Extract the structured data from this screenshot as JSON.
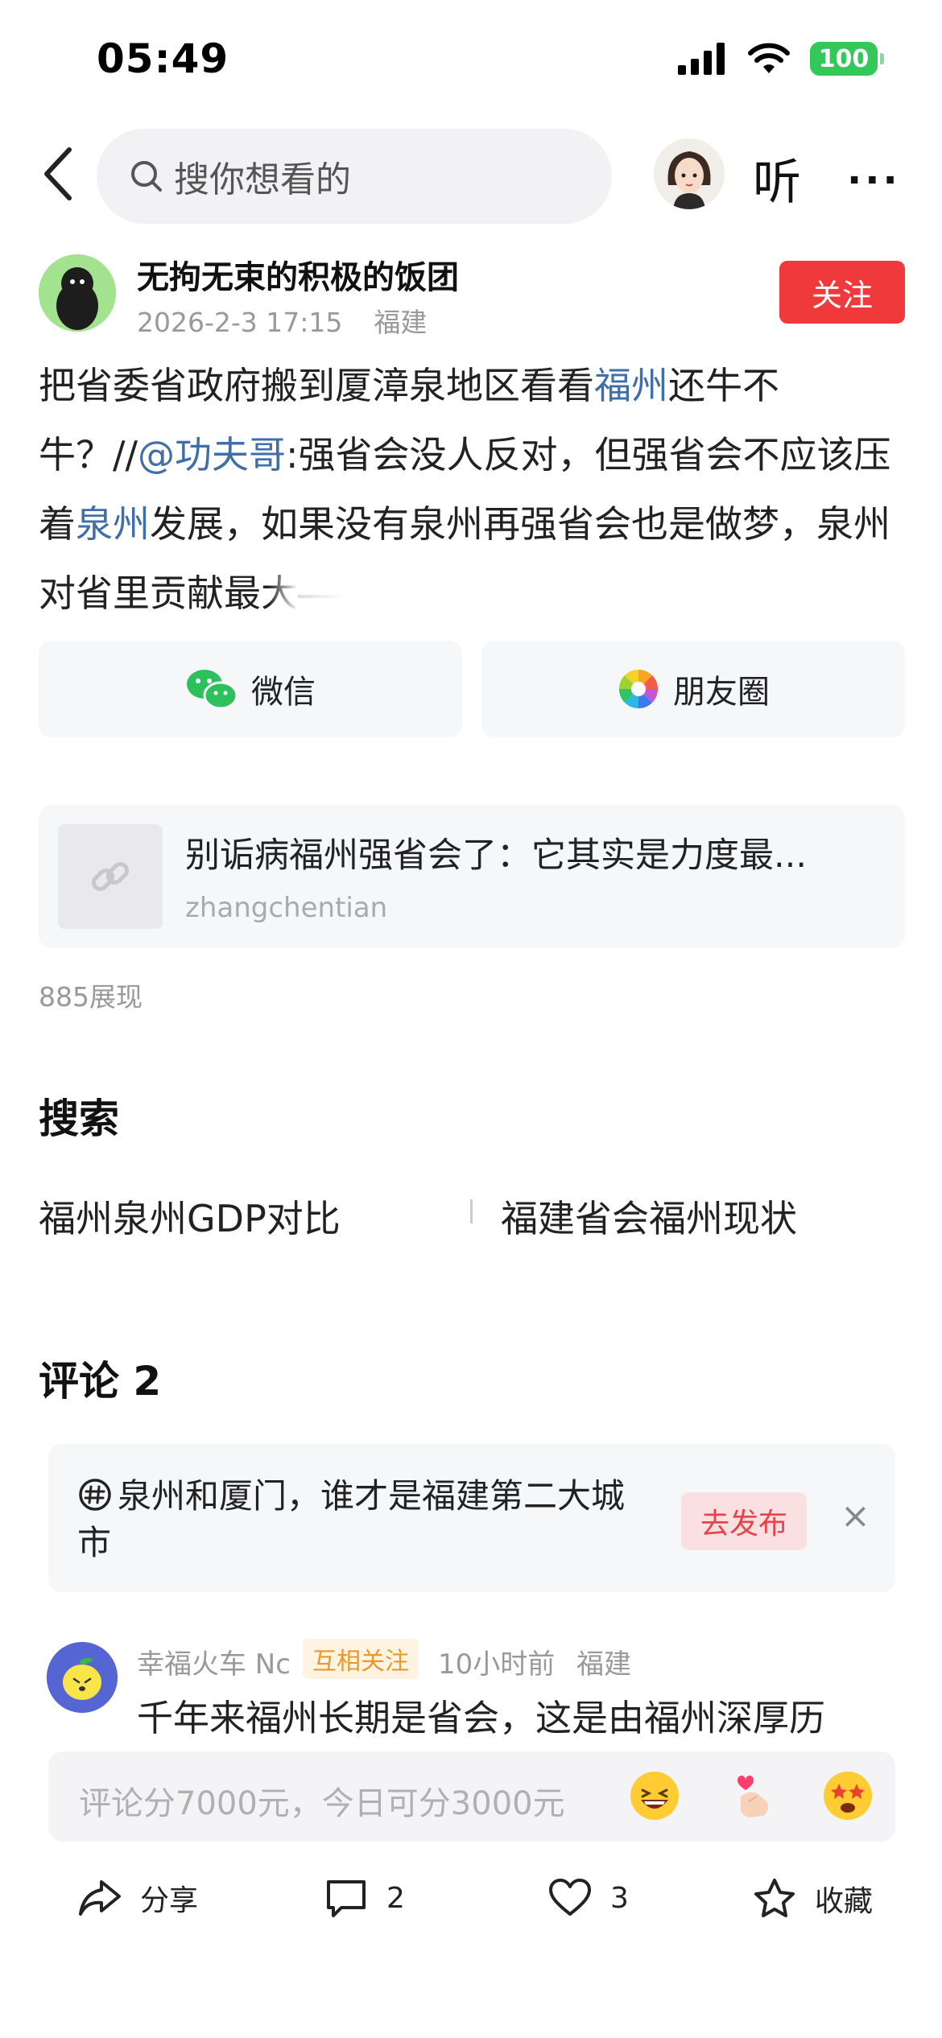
{
  "status_bar": {
    "time": "05:49",
    "battery": "100"
  },
  "top_bar": {
    "search_placeholder": "搜你想看的",
    "listen_label": "听",
    "more_label": "···"
  },
  "author": {
    "name": "无拘无束的积极的饭团",
    "date": "2026-2-3 17:15",
    "location": "福建",
    "follow_label": "关注"
  },
  "post": {
    "segments": [
      {
        "text": "把省委省政府搬到厦漳泉地区看看",
        "type": "text"
      },
      {
        "text": "福州",
        "type": "link"
      },
      {
        "text": "还牛不牛？//",
        "type": "text"
      },
      {
        "text": "@功夫哥",
        "type": "link"
      },
      {
        "text": ":强省会没人反对，但强省会不应该压着",
        "type": "text"
      },
      {
        "text": "泉州",
        "type": "link"
      },
      {
        "text": "发展，如果没有泉州再强省会也是做梦，泉州对省里贡献最",
        "type": "text"
      },
      {
        "text": "大",
        "type": "fade"
      }
    ]
  },
  "share": {
    "wechat_label": "微信",
    "moments_label": "朋友圈"
  },
  "link_card": {
    "title": "别诟病福州强省会了：它其实是力度最...",
    "source": "zhangchentian"
  },
  "views": "885展现",
  "search_section": {
    "title": "搜索",
    "suggestions": [
      "福州泉州GDP对比",
      "福建省会福州现状"
    ]
  },
  "comments": {
    "title": "评论 2",
    "topic": {
      "text": "泉州和厦门，谁才是福建第二大城市",
      "publish_label": "去发布",
      "close_label": "×"
    },
    "items": [
      {
        "user": "幸福火车 Nc",
        "badge": "互相关注",
        "time": "10小时前",
        "location": "福建",
        "text": "千年来福州长期是省会，这是由福州深厚历"
      }
    ],
    "input_placeholder": "评论分7000元，今日可分3000元"
  },
  "bottom_bar": {
    "share_label": "分享",
    "comment_count": "2",
    "like_count": "3",
    "favorite_label": "收藏"
  },
  "colors": {
    "link_blue": "#3f6ea8",
    "follow_red": "#f0393a",
    "battery_green": "#34c759",
    "badge_orange": "#e79a2c"
  }
}
